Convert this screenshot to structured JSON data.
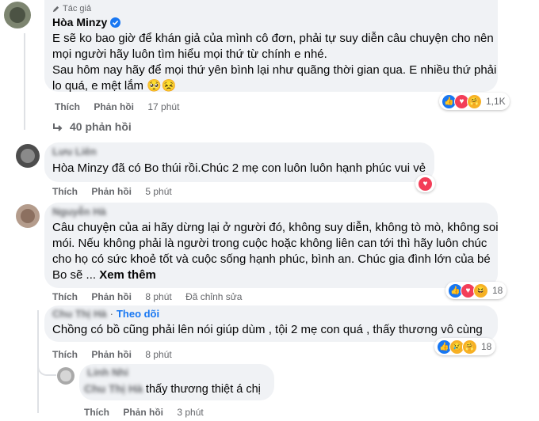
{
  "comments": [
    {
      "author_badge": "Tác giả",
      "author": "Hòa Minzy",
      "text_lines": [
        "E sẽ ko bao giờ để khán giả của mình cô đơn, phải tự suy diễn câu chuyện cho nên",
        "mọi người hãy luôn tìm hiểu mọi thứ từ chính e nhé.",
        "Sau hôm nay hãy để mọi thứ yên bình lại như quãng thời gian qua. E nhiều thứ phải",
        "lo quá, e mệt lắm 🥺😣"
      ],
      "like_label": "Thích",
      "reply_label": "Phản hồi",
      "time": "17 phút",
      "reaction_count": "1,1K",
      "replies_link": "40 phản hồi"
    },
    {
      "author": "Lưu Liên",
      "text_lines": [
        "Hòa Minzy đã có Bo thúi rồi.Chúc 2 mẹ con luôn luôn hạnh phúc vui vẻ"
      ],
      "like_label": "Thích",
      "reply_label": "Phản hồi",
      "time": "5 phút"
    },
    {
      "author": "Nguyễn Hà",
      "text_lines": [
        "Câu chuyện của ai hãy dừng lại ở người đó, không suy diễn, không tò mò, không soi",
        "mói. Nếu không phải là người trong cuộc hoặc không liên can tới thì hãy luôn chúc",
        "cho họ có sức khoẻ tốt và cuộc sống hạnh phúc, bình an. Chúc gia đình lớn của bé",
        "Bo sẽ ..."
      ],
      "see_more": "Xem thêm",
      "like_label": "Thích",
      "reply_label": "Phản hồi",
      "time": "8 phút",
      "edited": "Đã chỉnh sửa",
      "reaction_count": "18"
    },
    {
      "author": "Chu Thị Hà",
      "follow": "Theo dõi",
      "text_lines": [
        "Chồng có bồ cũng phải lên nói giúp dùm , tội 2 mẹ con quá , thấy thương vô cùng"
      ],
      "like_label": "Thích",
      "reply_label": "Phản hồi",
      "time": "8 phút",
      "reaction_count": "18"
    },
    {
      "author": "Linh Nhi",
      "mention": "Chu Thị Hà",
      "text": " thấy thương thiệt á chị",
      "like_label": "Thích",
      "reply_label": "Phản hồi",
      "time": "3 phút"
    }
  ],
  "colors": {
    "bubble": "#f0f2f5",
    "secondary_text": "#65676b",
    "like": "#1877f2",
    "love": "#f33e58",
    "care": "#f7b125"
  },
  "icons": [
    "pen-icon",
    "verified-badge-icon",
    "reply-arrow-icon",
    "like-reaction-icon",
    "love-reaction-icon",
    "care-reaction-icon",
    "haha-reaction-icon",
    "sad-reaction-icon"
  ]
}
